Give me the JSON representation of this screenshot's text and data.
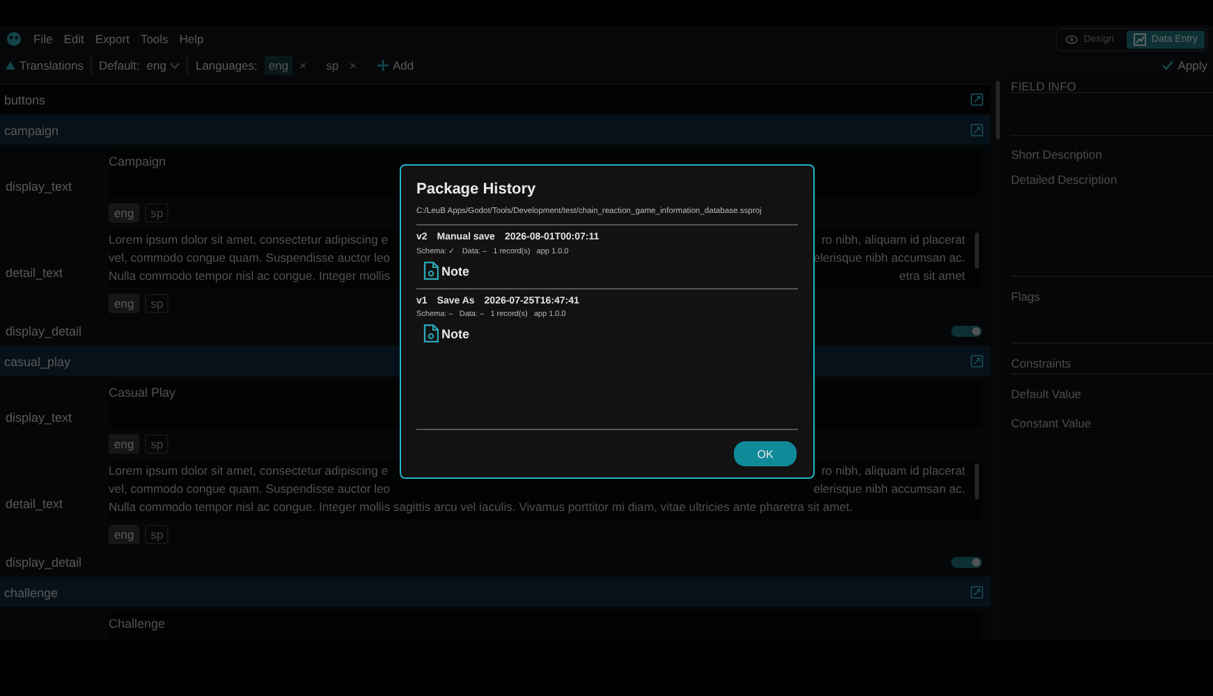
{
  "menu": [
    "File",
    "Edit",
    "Export",
    "Tools",
    "Help"
  ],
  "view_modes": [
    {
      "label": "Design",
      "selected": false
    },
    {
      "label": "Data Entry",
      "selected": true
    }
  ],
  "toolbar": {
    "translations": "Translations",
    "default_label": "Default:",
    "default_value": "eng",
    "languages_label": "Languages:",
    "languages": [
      {
        "code": "eng",
        "selected": true
      },
      {
        "code": "sp",
        "selected": false
      }
    ],
    "remove": "×",
    "add": "Add",
    "apply": "Apply"
  },
  "rows": [
    {
      "kind": "group",
      "name": "buttons",
      "expanded": false
    },
    {
      "kind": "group",
      "name": "campaign",
      "expanded": true
    },
    {
      "kind": "text",
      "name": "display_text",
      "value": "Campaign",
      "languages": [
        {
          "code": "eng",
          "selected": true
        },
        {
          "code": "sp",
          "selected": false
        }
      ]
    },
    {
      "kind": "detail",
      "name": "detail_text",
      "lines": [
        [
          "Lorem ipsum dolor sit amet, consectetur adipiscing e",
          "ro nibh, aliquam id placerat"
        ],
        [
          "vel, commodo congue quam. Suspendisse auctor leo",
          "elerisque nibh accumsan ac."
        ],
        [
          "Nulla commodo tempor nisl ac congue. Integer mollis",
          "etra sit amet"
        ]
      ],
      "languages": [
        {
          "code": "eng",
          "selected": true
        },
        {
          "code": "sp",
          "selected": false
        }
      ]
    },
    {
      "kind": "toggle",
      "name": "display_detail",
      "on": true
    },
    {
      "kind": "group",
      "name": "casual_play",
      "expanded": true
    },
    {
      "kind": "text",
      "name": "display_text",
      "value": "Casual Play",
      "languages": [
        {
          "code": "eng",
          "selected": true
        },
        {
          "code": "sp",
          "selected": false
        }
      ]
    },
    {
      "kind": "detail",
      "name": "detail_text",
      "lines": [
        [
          "Lorem ipsum dolor sit amet, consectetur adipiscing e",
          "ro nibh, aliquam id placerat"
        ],
        [
          "vel, commodo congue quam. Suspendisse auctor leo",
          "elerisque nibh accumsan ac."
        ],
        [
          "Nulla commodo tempor nisl ac congue. Integer mollis sagittis arcu vel iaculis. Vivamus porttitor mi diam, vitae ultricies ante pharetra sit amet."
        ]
      ],
      "languages": [
        {
          "code": "eng",
          "selected": true
        },
        {
          "code": "sp",
          "selected": false
        }
      ]
    },
    {
      "kind": "toggle",
      "name": "display_detail",
      "on": true
    },
    {
      "kind": "group",
      "name": "challenge",
      "expanded": true
    },
    {
      "kind": "text",
      "value": "Challenge"
    }
  ],
  "field_info": [
    "FIELD INFO",
    "Short Description",
    "Detailed Description",
    "Flags",
    "Constraints",
    "Default Value",
    "Constant Value"
  ],
  "dialog": {
    "title": "Package History",
    "path": "C:/LeuB Apps/Godot/Tools/Development/test/chain_reaction_game_information_database.ssproj",
    "entries": [
      {
        "version": "v2",
        "action": "Manual save",
        "timestamp": "2026-08-01T00:07:11",
        "meta": "Schema: ✓   Data: –   1 record(s)   app 1.0.0",
        "note": "Note"
      },
      {
        "version": "v1",
        "action": "Save As",
        "timestamp": "2026-07-25T16:47:41",
        "meta": "Schema: –   Data: –   1 record(s)   app 1.0.0",
        "note": "Note"
      }
    ],
    "ok": "OK"
  }
}
